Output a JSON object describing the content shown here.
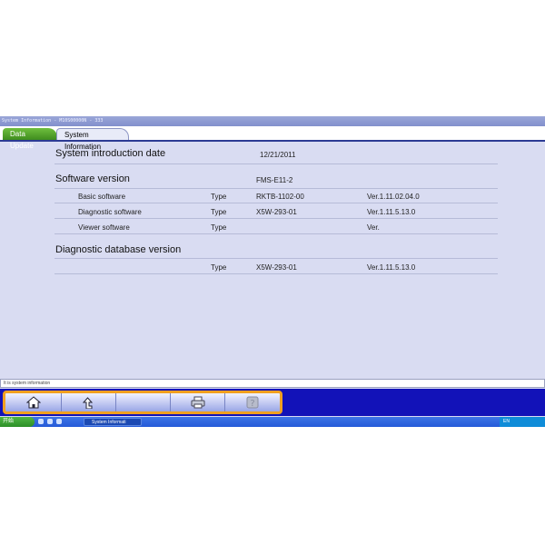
{
  "window": {
    "title": "System Information - M10S00000N - 333"
  },
  "tabs": [
    {
      "label": "Data Update"
    },
    {
      "label": "System Information"
    }
  ],
  "sections": {
    "intro": {
      "label": "System introduction date",
      "value": "12/21/2011"
    },
    "software": {
      "label": "Software version",
      "value": "FMS-E11-2",
      "rows": [
        {
          "name": "Basic software",
          "type": "Type",
          "id": "RKTB-1102-00",
          "ver": "Ver.1.11.02.04.0"
        },
        {
          "name": "Diagnostic software",
          "type": "Type",
          "id": "X5W-293-01",
          "ver": "Ver.1.11.5.13.0"
        },
        {
          "name": "Viewer software",
          "type": "Type",
          "id": "",
          "ver": "Ver."
        }
      ]
    },
    "database": {
      "label": "Diagnostic database version",
      "row": {
        "type": "Type",
        "id": "X5W-293-01",
        "ver": "Ver.1.11.5.13.0"
      }
    }
  },
  "status": {
    "text": "It is system information"
  },
  "toolbar": {
    "buttons": [
      {
        "icon": "home-icon"
      },
      {
        "icon": "back-icon"
      },
      {
        "icon": "blank"
      },
      {
        "icon": "print-icon"
      },
      {
        "icon": "help-icon"
      }
    ]
  },
  "taskbar": {
    "start_label": "开始",
    "task_label": "System Informati",
    "tray_text": "EN"
  }
}
